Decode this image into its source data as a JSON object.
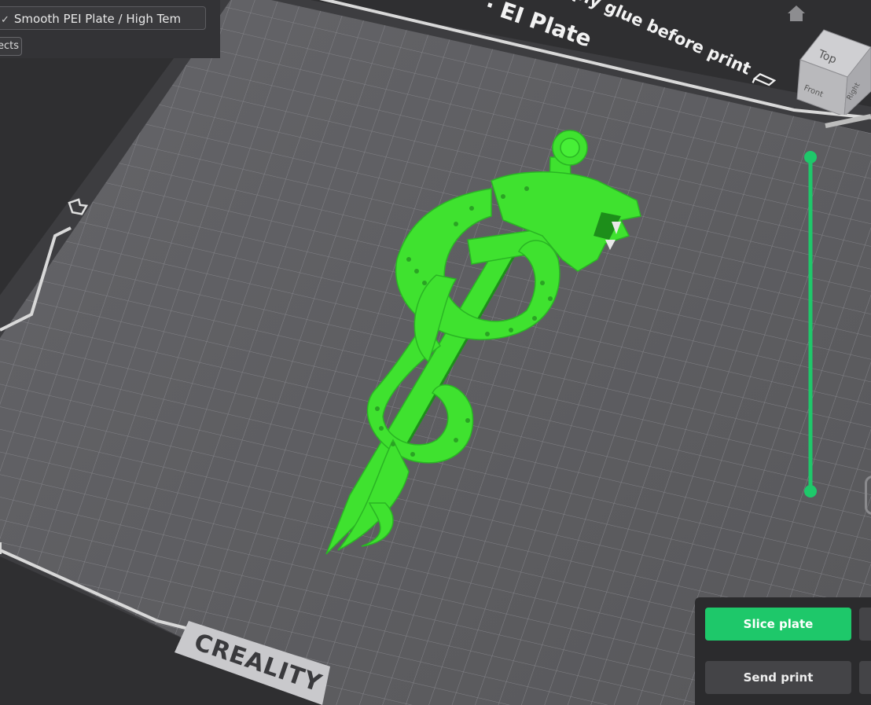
{
  "plate_selector": {
    "chevron": "✓",
    "label": "Smooth PEI Plate / High Tem"
  },
  "objects_button": {
    "label": "ects"
  },
  "bed": {
    "title_text": "· EI Plate",
    "notice_text": "ply glue before print",
    "brand": "CREALITY"
  },
  "view_cube": {
    "top": "Top",
    "front": "Front",
    "right": "Right"
  },
  "actions": {
    "slice_label": "Slice plate",
    "send_label": "Send print"
  },
  "colors": {
    "model": "#3fe22f",
    "accent": "#1ec86a",
    "bed": "#5e5e61",
    "grid": "#838387"
  },
  "icons": {
    "home": "home-icon",
    "glue": "glue-icon",
    "bed_marker": "bed-origin-icon"
  }
}
